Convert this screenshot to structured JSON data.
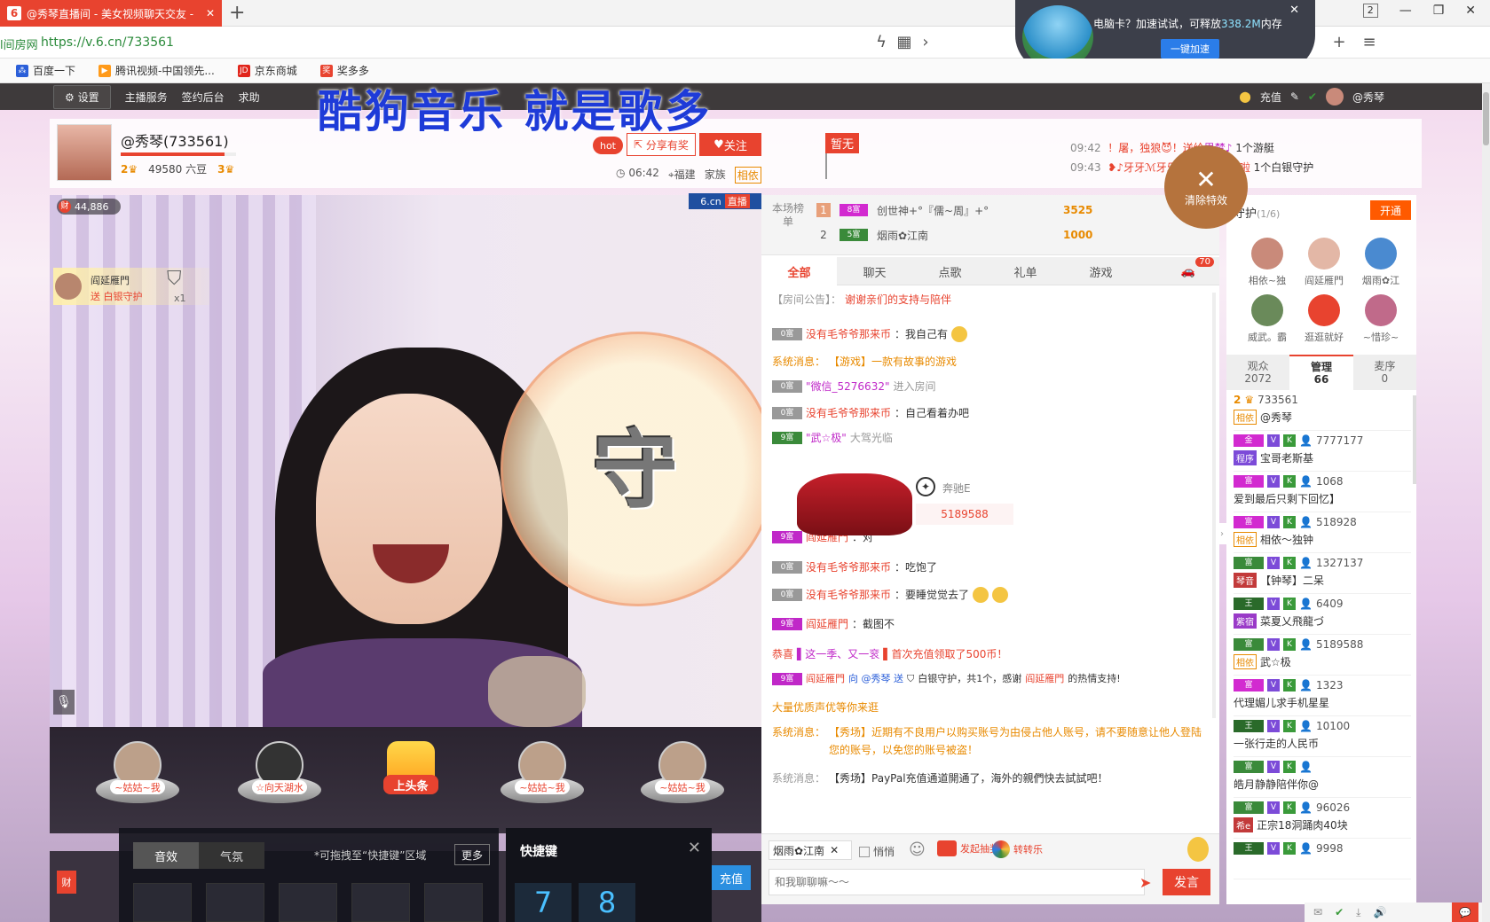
{
  "browser": {
    "tab_title": "@秀琴直播间 - 美女视频聊天交友 -",
    "tab_close": "✕",
    "new_tab": "+",
    "url_prefix": "l间房网",
    "url": "https://v.6.cn/733561",
    "bookmarks": [
      {
        "label": "百度一下",
        "color": "#2b5fd9"
      },
      {
        "label": "腾讯视频-中国领先...",
        "color": "#ff9a1a"
      },
      {
        "label": "京东商城",
        "color": "#e1251b"
      },
      {
        "label": "奖多多",
        "color": "#e8432f"
      }
    ],
    "window_counter": "2",
    "pc_widget": {
      "text_prefix": "电脑卡？加速试试，可释放",
      "amount": "338.2M",
      "text_suffix": "内存",
      "button": "一键加速"
    }
  },
  "site_header": {
    "settings": "设置",
    "links": [
      "主播服务",
      "签约后台",
      "求助"
    ],
    "recharge": "充值",
    "username": "@秀琴"
  },
  "watermark": "酷狗音乐  就是歌多",
  "streamer": {
    "name": "@秀琴(733561)",
    "level_left": "2",
    "beans": "49580 六豆",
    "level_right": "3",
    "hot": "hot",
    "share": "分享有奖",
    "follow": "关注",
    "time": "06:42",
    "location": "福建",
    "family": "家族",
    "family_tag": "相依",
    "flag": "暂无"
  },
  "news": [
    {
      "time": "09:42",
      "text": "！屠，独狼😈！送给",
      "highlight": "思梦♪",
      "suffix": "1个游艇"
    },
    {
      "time": "09:43",
      "text": "❥♪牙牙ℳ",
      "highlight": "牙乐❤代理求充值啦",
      "suffix": "1个白银守护"
    }
  ],
  "clear_fx": "清除特效",
  "video": {
    "wealth": "44,886",
    "badge": "6.cn",
    "badge_live": "直播",
    "orb_glyph": "守",
    "guard_tip": {
      "name": "阎延雁門",
      "text": "送 白银守护",
      "count": "x1"
    }
  },
  "gift_podiums": [
    {
      "label": "~姑姑~我"
    },
    {
      "label": "☆向天湖水"
    },
    {
      "label": "上头条"
    },
    {
      "label": "~姑姑~我"
    },
    {
      "label": "~姑姑~我"
    }
  ],
  "dock": {
    "red_label": "财",
    "recharge": "充值"
  },
  "sound_panel": {
    "tabs": [
      "音效",
      "气氛"
    ],
    "hint": "*可拖拽至“快捷键”区域",
    "more": "更多"
  },
  "hotkey_panel": {
    "title": "快捷键",
    "close": "✕",
    "keys": [
      "7",
      "8"
    ]
  },
  "rank": {
    "label": "本场榜单",
    "rows": [
      {
        "no": "1",
        "lv": "8富",
        "nick": "创世神+°『儒~周』+°",
        "coins": "3525"
      },
      {
        "no": "2",
        "lv": "5富",
        "nick": "烟雨✿江南",
        "coins": "1000"
      }
    ]
  },
  "chat_tabs": [
    "全部",
    "聊天",
    "点歌",
    "礼单",
    "游戏"
  ],
  "chat_car_count": "70",
  "messages": {
    "notice_label": "【房间公告】：",
    "notice_text": "谢谢亲们的支持与陪伴",
    "m1": {
      "lv": "0富",
      "name": "没有毛爷爷那来币",
      "text": "：我自己有"
    },
    "m2": {
      "label": "系统消息：",
      "text": "【游戏】一款有故事的游戏"
    },
    "m3": {
      "lv": "0富",
      "name": "\"微信_5276632\"",
      "text": "进入房间"
    },
    "m4": {
      "lv": "0富",
      "name": "没有毛爷爷那来币",
      "text": "：自己看着办吧"
    },
    "m5": {
      "lv": "9富",
      "name": "\"武☆极\"",
      "text": "大驾光临"
    },
    "car_name": "奔驰E",
    "car_id": "5189588",
    "m6": {
      "lv": "9富",
      "name": "阎延雁門",
      "text": "：对"
    },
    "m7": {
      "lv": "0富",
      "name": "没有毛爷爷那来币",
      "text": "：吃饱了"
    },
    "m8": {
      "lv": "0富",
      "name": "没有毛爷爷那来币",
      "text": "：要睡觉觉去了"
    },
    "m9": {
      "lv": "9富",
      "name": "阎延雁門",
      "text": "：截图不"
    },
    "m10": {
      "label": "恭喜",
      "name": "▌这一季、又一衮",
      "text": "▌首次充值领取了500币！"
    },
    "m11": {
      "lv": "9富",
      "name": "阎延雁門",
      "mid": "向 @秀琴 送",
      "text": "白银守护，共1个，感谢",
      "name2": "阎延雁門",
      "tail": "的热情支持!"
    },
    "m12": {
      "text": "大量优质声优等你来逛"
    },
    "m13": {
      "label": "系统消息：",
      "text": "【秀场】近期有不良用户以购买账号为由侵占他人账号，请不要随意让他人登陆您的账号，以免您的账号被盗！"
    },
    "m14": {
      "label": "系统消息：",
      "text": "【秀场】PayPal充值通道開通了，海外的親們快去試試吧！"
    }
  },
  "input_bar": {
    "recipient": "烟雨✿江南",
    "whisper": "悄悄",
    "fast_luck": "发起抽奖",
    "wheel": "转转乐",
    "placeholder": "和我聊聊嘛～～",
    "send": "发言"
  },
  "guard": {
    "title": "守护",
    "count": "(1/6)",
    "open": "开通",
    "members": [
      "相依~独",
      "阎延雁門",
      "烟雨✿江",
      "威武。霸",
      "逛逛就好",
      "~惜珍~"
    ]
  },
  "user_tabs": [
    {
      "label": "观众",
      "count": "2072"
    },
    {
      "label": "管理",
      "count": "66"
    },
    {
      "label": "麦序",
      "count": "0"
    }
  ],
  "users": [
    {
      "id": "733561",
      "name": "@秀琴",
      "tag": "相依",
      "lv": "2"
    },
    {
      "id": "7777177",
      "name": "宝哥老斯基",
      "tag": "程序",
      "lv": "金"
    },
    {
      "id": "1068",
      "name": "爱到最后只剩下回忆】",
      "tag": "",
      "lv": "富"
    },
    {
      "id": "518928",
      "name": "相依～独钟",
      "tag": "相依",
      "lv": "富"
    },
    {
      "id": "1327137",
      "name": "【钟琴】二呆",
      "tag": "琴音",
      "lv": "富"
    },
    {
      "id": "6409",
      "name": "菜夏乂飛龍づ",
      "tag": "紫宿",
      "lv": "王"
    },
    {
      "id": "5189588",
      "name": "武☆极",
      "tag": "相依",
      "lv": "富"
    },
    {
      "id": "1323",
      "name": "代理媚儿求手机星星",
      "tag": "",
      "lv": "富"
    },
    {
      "id": "10100",
      "name": "一张行走的人民币",
      "tag": "",
      "lv": "王"
    },
    {
      "id": "",
      "name": "皓月静静陪伴你@",
      "tag": "",
      "lv": "富"
    },
    {
      "id": "96026",
      "name": "正宗18洞踊肉40块",
      "tag": "希e",
      "lv": "富"
    },
    {
      "id": "9998",
      "name": "",
      "tag": "",
      "lv": "王"
    }
  ]
}
